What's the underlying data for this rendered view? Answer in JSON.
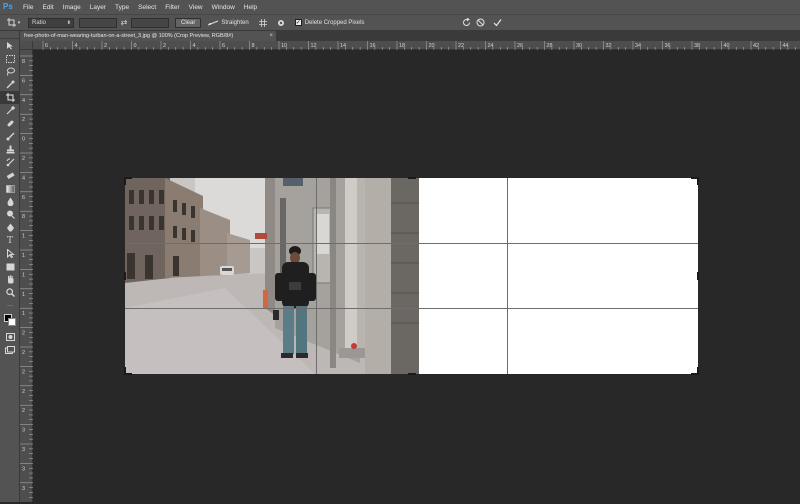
{
  "app": {
    "logo": "Ps"
  },
  "menu": [
    "File",
    "Edit",
    "Image",
    "Layer",
    "Type",
    "Select",
    "Filter",
    "View",
    "Window",
    "Help"
  ],
  "options": {
    "tool_icon": "crop-icon",
    "ratio_select": "Ratio",
    "clear_label": "Clear",
    "straighten_label": "Straighten",
    "delete_cropped_label": "Delete Cropped Pixels",
    "delete_cropped_checked": true
  },
  "document": {
    "tab_title": "free-photo-of-man-wearing-turban-on-a-street_3.jpg @ 100% (Crop Preview, RGB/8#)",
    "close_glyph": "×"
  },
  "rulers": {
    "h_ticks": [
      "6",
      "4",
      "2",
      "0",
      "2",
      "4",
      "6",
      "8",
      "10",
      "12",
      "14",
      "16",
      "18",
      "20",
      "22",
      "24",
      "26",
      "28",
      "30",
      "32",
      "34",
      "36",
      "38",
      "40",
      "42",
      "44"
    ],
    "v_ticks": [
      "8",
      "6",
      "4",
      "2",
      "0",
      "2",
      "4",
      "6",
      "8",
      "1",
      "1",
      "1",
      "1",
      "1",
      "2",
      "2",
      "2",
      "2",
      "2",
      "3",
      "3",
      "3",
      "3"
    ]
  },
  "tools": [
    "move-icon",
    "marquee-icon",
    "lasso-icon",
    "quick-select-icon",
    "crop-icon",
    "eyedropper-icon",
    "healing-icon",
    "brush-icon",
    "clone-stamp-icon",
    "history-brush-icon",
    "eraser-icon",
    "gradient-icon",
    "blur-icon",
    "dodge-icon",
    "pen-icon",
    "type-icon",
    "path-select-icon",
    "rectangle-icon",
    "hand-icon",
    "zoom-icon",
    "extras-icon",
    "color-swatches-icon",
    "quick-mask-icon",
    "screen-mode-icon"
  ],
  "colors": {
    "accent": "#4aa7f0",
    "canvas_bg": "#282828",
    "panel_bg": "#535353"
  }
}
